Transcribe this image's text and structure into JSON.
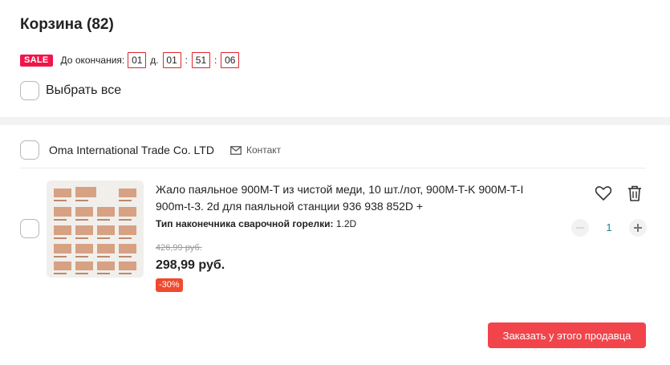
{
  "cart": {
    "title": "Корзина (82)"
  },
  "sale": {
    "badge": "SALE",
    "until_label": "До окончания:",
    "days": "01",
    "days_label": "д.",
    "hours": "01",
    "minutes": "51",
    "seconds": "06"
  },
  "select_all": {
    "label": "Выбрать все",
    "checked": false
  },
  "seller": {
    "name": "Oma International Trade Co. LTD",
    "contact_label": "Контакт",
    "checked": false
  },
  "item": {
    "title": "Жало паяльное 900M-T из чистой меди, 10 шт./лот, 900M-T-K 900M-T-I 900m-t-3. 2d для паяльной станции 936 938 852D +",
    "prop_label": "Тип наконечника сварочной горелки:",
    "prop_value": "1.2D",
    "old_price": "426,99 руб.",
    "price": "298,99 руб.",
    "discount": "-30%",
    "quantity": "1",
    "checked": false
  },
  "order_button": {
    "label": "Заказать у этого продавца"
  },
  "icons": {
    "favorite": "heart-outline-icon",
    "delete": "trash-icon",
    "contact": "envelope-icon"
  },
  "colors": {
    "accent": "#f2444b",
    "sale": "#f0164a",
    "discount": "#f04a2e",
    "timer_border": "#e0242a",
    "quantity": "#20808e"
  }
}
